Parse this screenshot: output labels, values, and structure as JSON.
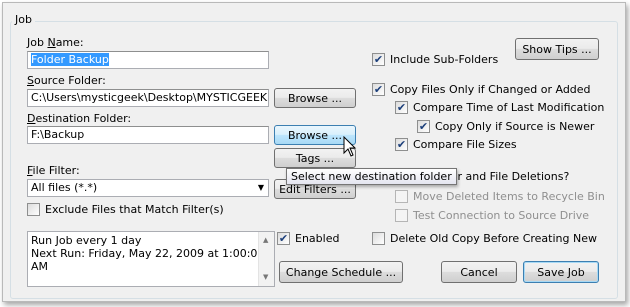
{
  "group": {
    "title": "Job"
  },
  "job_name": {
    "label_prefix": "Job ",
    "label_key": "N",
    "label_suffix": "ame:",
    "value": "Folder Backup"
  },
  "source": {
    "label_key": "S",
    "label_rest": "ource Folder:",
    "value": "C:\\Users\\mysticgeek\\Desktop\\MYSTICGEEK M",
    "browse": "Browse ..."
  },
  "destination": {
    "label_key": "D",
    "label_rest": "estination Folder:",
    "value": "F:\\Backup",
    "browse": "Browse ...",
    "tags": "Tags ..."
  },
  "filter": {
    "label_key": "F",
    "label_rest": "ile Filter:",
    "value": "All files (*.*)",
    "edit": "Edit Filters ...",
    "exclude": "Exclude Files that Match Filter(s)",
    "exclude_checked": false
  },
  "tooltip": "Select new destination folder",
  "options": {
    "show_tips": "Show Tips ...",
    "include_sub": {
      "label": "Include Sub-Folders",
      "checked": true
    },
    "copy_changed": {
      "label": "Copy Files Only if Changed or Added",
      "checked": true
    },
    "compare_time": {
      "label": "Compare Time of Last Modification",
      "checked": true
    },
    "copy_newer": {
      "label": "Copy Only if Source is Newer",
      "checked": true
    },
    "compare_size": {
      "label": "Compare File Sizes",
      "checked": true
    },
    "deletions_label": "Folder and File Deletions?",
    "move_recycle": {
      "label": "Move Deleted Items to Recycle Bin",
      "checked": false
    },
    "test_connection": {
      "label": "Test Connection to Source Drive",
      "checked": false
    }
  },
  "schedule": {
    "line1": "Run Job every 1 day",
    "line2": "Next Run: Friday, May 22, 2009 at 1:00:00",
    "line3": "AM",
    "enabled": {
      "label": "Enabled",
      "checked": true
    },
    "change": "Change Schedule ..."
  },
  "delete_old": {
    "label": "Delete Old Copy Before Creating New",
    "checked": false
  },
  "footer": {
    "cancel": "Cancel",
    "save": "Save Job"
  },
  "icons": {
    "check": "✔",
    "dropdown": "▼",
    "scroll_up": "▲",
    "scroll_down": "▼"
  }
}
